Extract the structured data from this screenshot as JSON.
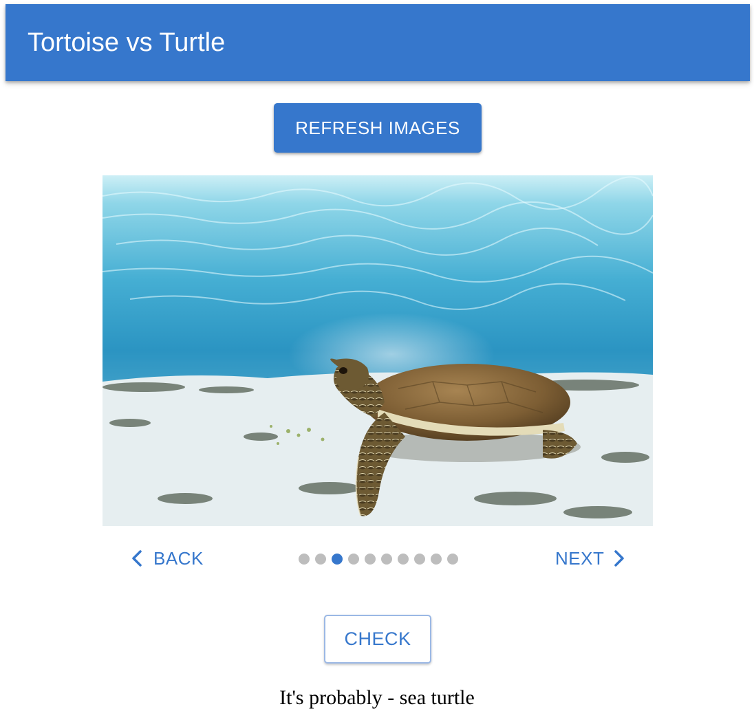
{
  "app": {
    "title": "Tortoise vs Turtle",
    "accent_color": "#3677cc"
  },
  "actions": {
    "refresh_label": "REFRESH IMAGES",
    "check_label": "CHECK"
  },
  "carousel": {
    "image": {
      "alt": "Sea turtle resting on the sandy sea floor",
      "icon": "sea-turtle-photo"
    },
    "back_label": "BACK",
    "next_label": "NEXT",
    "total_steps": 10,
    "active_step": 3
  },
  "result": {
    "text": "It's probably - sea turtle"
  }
}
